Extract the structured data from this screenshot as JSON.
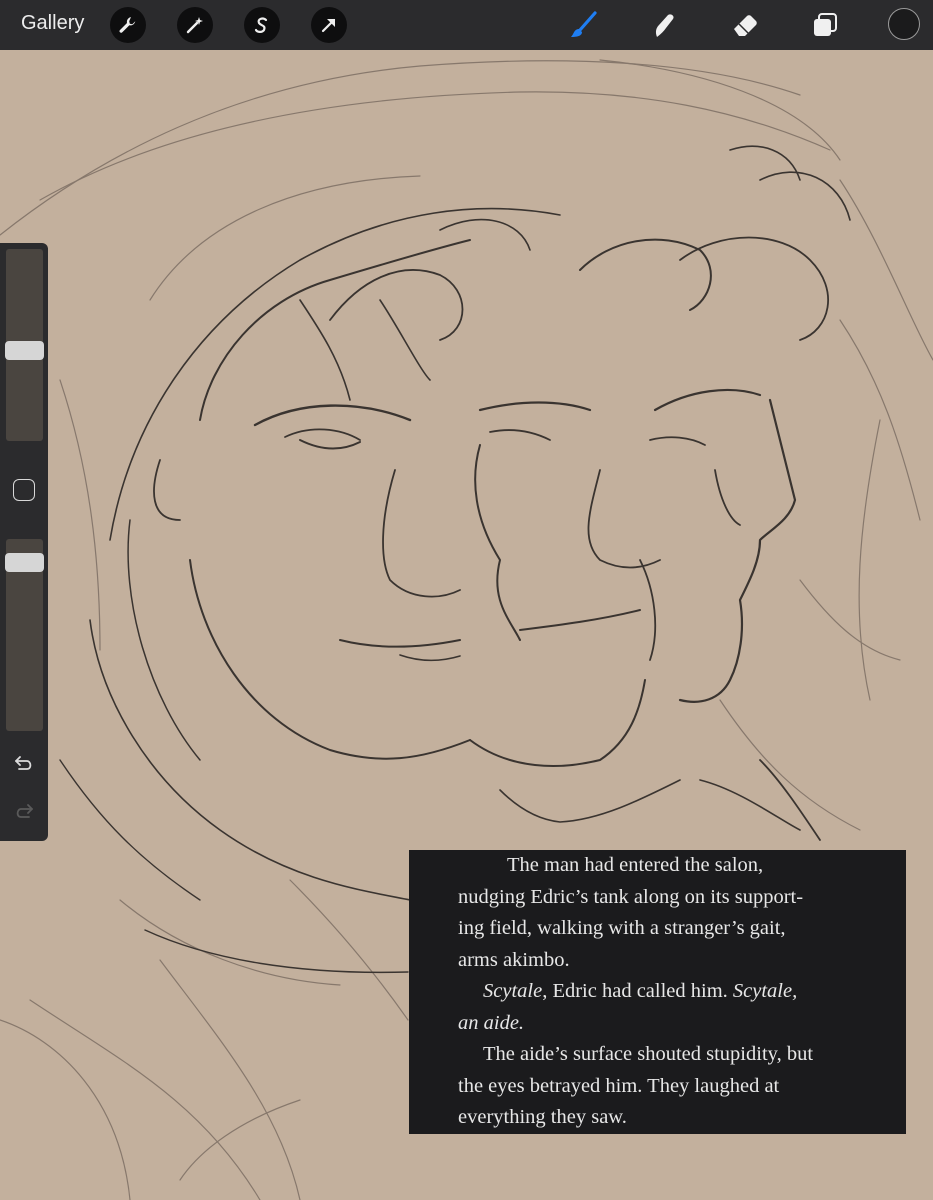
{
  "toolbar": {
    "gallery_label": "Gallery",
    "left_tools": [
      {
        "name": "wrench-icon"
      },
      {
        "name": "magic-wand-icon"
      },
      {
        "name": "selection-s-icon"
      },
      {
        "name": "arrow-transform-icon"
      }
    ],
    "right_tools": [
      {
        "name": "brush-icon",
        "active": true,
        "color": "#1f7ef2"
      },
      {
        "name": "smudge-icon"
      },
      {
        "name": "eraser-icon"
      },
      {
        "name": "layers-icon"
      }
    ],
    "current_color": "#1b1b1c"
  },
  "sidebar": {
    "brush_size_level": 0.47,
    "opacity_level": 0.08,
    "modifier_icon": "square-icon",
    "undo_icon": "undo-icon",
    "redo_icon": "redo-icon"
  },
  "canvas": {
    "background_color": "#c3b09d",
    "subject": "pencil sketch"
  },
  "quote": {
    "lines": [
      {
        "text": "The man had entered the salon,",
        "style": "indent-big"
      },
      {
        "text": "nudging Edric’s tank along on its support-",
        "style": ""
      },
      {
        "text": "ing field, walking with a stranger’s gait,",
        "style": ""
      },
      {
        "text": "arms akimbo.",
        "style": ""
      }
    ],
    "line5_italic1": "Scytale",
    "line5_normal": ", Edric had called him. ",
    "line5_italic2": "Scytale,",
    "line6_italic": "an aide.",
    "lines_end": [
      {
        "text": "The aide’s surface shouted stupidity, but",
        "style": "indent"
      },
      {
        "text": "the eyes betrayed him. They laughed at",
        "style": ""
      },
      {
        "text": "everything they saw.",
        "style": ""
      }
    ]
  }
}
